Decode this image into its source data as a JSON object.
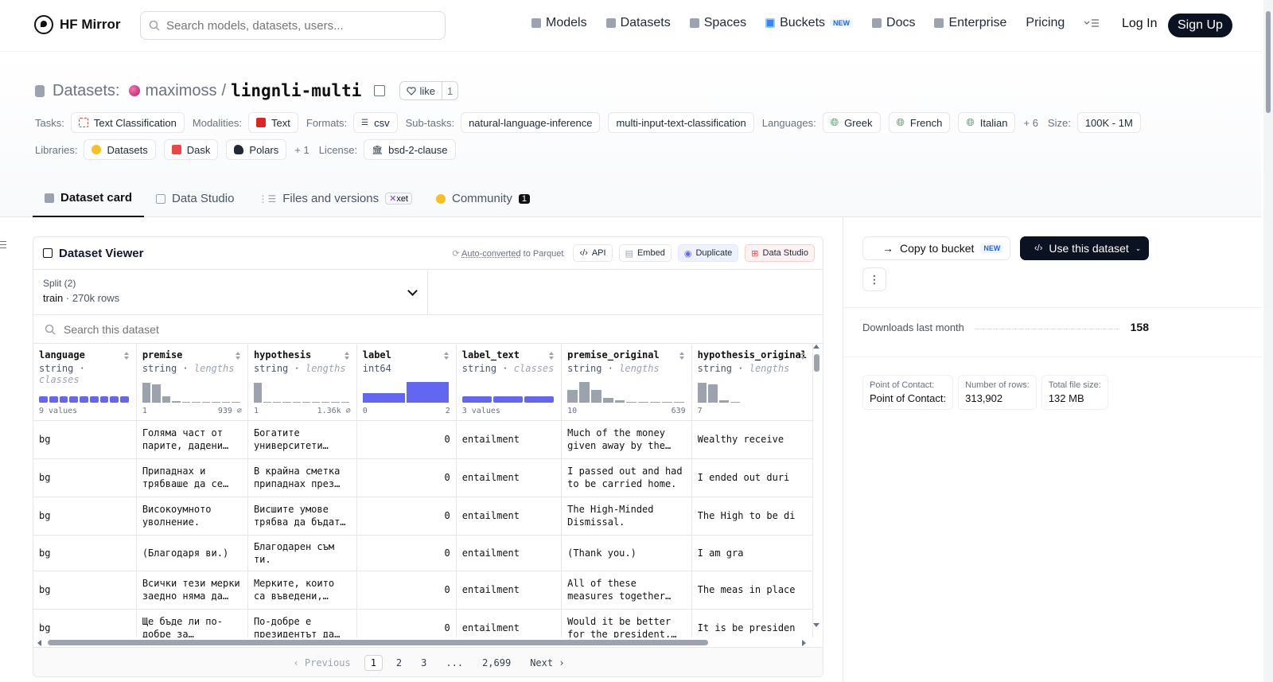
{
  "nav": {
    "brand": "HF Mirror",
    "search_placeholder": "Search models, datasets, users...",
    "links": [
      {
        "label": "Models",
        "icon": "cube-icon"
      },
      {
        "label": "Datasets",
        "icon": "database-icon"
      },
      {
        "label": "Spaces",
        "icon": "grid-icon"
      },
      {
        "label": "Buckets",
        "icon": "bucket-icon",
        "badge": "NEW"
      },
      {
        "label": "Docs",
        "icon": "book-icon"
      },
      {
        "label": "Enterprise",
        "icon": "enterprise-icon"
      },
      {
        "label": "Pricing"
      }
    ],
    "login": "Log In",
    "signup": "Sign Up"
  },
  "header": {
    "section": "Datasets:",
    "owner": "maximoss",
    "separator": "/",
    "repo": "lingnli-multi",
    "like_label": "like",
    "like_count": "1"
  },
  "tags": {
    "tasks_label": "Tasks:",
    "task": "Text Classification",
    "modalities_label": "Modalities:",
    "modality": "Text",
    "formats_label": "Formats:",
    "format": "csv",
    "subtasks_label": "Sub-tasks:",
    "subtasks": [
      "natural-language-inference",
      "multi-input-text-classification"
    ],
    "languages_label": "Languages:",
    "languages": [
      "Greek",
      "French",
      "Italian"
    ],
    "languages_more": "+ 6",
    "size_label": "Size:",
    "size": "100K - 1M",
    "libraries_label": "Libraries:",
    "libraries": [
      "Datasets",
      "Dask",
      "Polars"
    ],
    "libraries_more": "+ 1",
    "license_label": "License:",
    "license": "bsd-2-clause"
  },
  "tabs": {
    "card": "Dataset card",
    "studio": "Data Studio",
    "files": "Files and versions",
    "xet": "xet",
    "community": "Community",
    "community_count": "1"
  },
  "viewer": {
    "title": "Dataset Viewer",
    "auto_link": "Auto-converted",
    "auto_rest": "to Parquet",
    "api": "API",
    "embed": "Embed",
    "duplicate": "Duplicate",
    "studio": "Data Studio",
    "split_label": "Split (2)",
    "split_value": "train",
    "split_rows": "270k rows",
    "search_placeholder": "Search this dataset",
    "columns": [
      {
        "name": "language",
        "type": "string",
        "kind": "classes",
        "left": "9 values",
        "right": "",
        "hist": "classes",
        "bars": [
          1,
          1,
          1,
          1,
          1,
          1,
          1,
          1,
          1
        ]
      },
      {
        "name": "premise",
        "type": "string",
        "kind": "lengths",
        "left": "1",
        "right": "939 ⌀",
        "hist": "lengths",
        "bars": [
          0.95,
          0.9,
          0.3,
          0.08,
          0.05,
          0.04,
          0.03,
          0,
          0.03,
          0.02
        ]
      },
      {
        "name": "hypothesis",
        "type": "string",
        "kind": "lengths",
        "left": "1",
        "right": "1.36k ⌀",
        "hist": "lengths",
        "bars": [
          0.95,
          0.05,
          0.04,
          0.03,
          0.03,
          0.02,
          0.02,
          0.02,
          0.02,
          0.02
        ]
      },
      {
        "name": "label",
        "type": "int64",
        "kind": "",
        "left": "0",
        "right": "2",
        "hist": "two",
        "bars": [
          0.45,
          1
        ]
      },
      {
        "name": "label_text",
        "type": "string",
        "kind": "classes",
        "left": "3 values",
        "right": "",
        "hist": "classes",
        "bars": [
          1,
          1,
          1
        ]
      },
      {
        "name": "premise_original",
        "type": "string",
        "kind": "lengths",
        "left": "10",
        "right": "639",
        "hist": "lengths",
        "bars": [
          0.6,
          1,
          0.6,
          0.25,
          0.1,
          0.05,
          0.04,
          0.03,
          0.03,
          0.02
        ]
      },
      {
        "name": "hypothesis_original",
        "type": "string",
        "kind": "lengths",
        "left": "7",
        "right": "",
        "hist": "lengths",
        "bars": [
          0.95,
          0.9,
          0.1,
          0.05
        ]
      }
    ],
    "rows": [
      [
        "bg",
        "Голяма част от парите, дадени от…",
        "Богатите университети…",
        "0",
        "entailment",
        "Much of the money given away by the…",
        "Wealthy receive"
      ],
      [
        "bg",
        "Припаднах и трябваше да се…",
        "В крайна сметка припаднах през…",
        "0",
        "entailment",
        "I passed out and had to be carried home.",
        "I ended out duri"
      ],
      [
        "bg",
        "Високоумното уволнение.",
        "Висшите умове трябва да бъдат…",
        "0",
        "entailment",
        "The High-Minded Dismissal.",
        "The High to be di"
      ],
      [
        "bg",
        "(Благодаря ви.)",
        "Благодарен съм ти.",
        "0",
        "entailment",
        "(Thank you.)",
        "I am gra"
      ],
      [
        "bg",
        "Всички тези мерки заедно няма да…",
        "Мерките, които са въведени, биха…",
        "0",
        "entailment",
        "All of these measures together will not…",
        "The meas in place"
      ],
      [
        "bg",
        "Ще бъде ли по-добре за президента, а…",
        "По-добре е президентът да…",
        "0",
        "entailment",
        "Would it be better for the president, and th…",
        "It is be presiden"
      ]
    ],
    "pager": {
      "prev": "Previous",
      "pages": [
        "1",
        "2",
        "3",
        "...",
        "2,699"
      ],
      "next": "Next"
    }
  },
  "sidebar": {
    "copy": "Copy to bucket",
    "copy_badge": "NEW",
    "use": "Use this dataset",
    "more": "⋮",
    "downloads_label": "Downloads last month",
    "downloads": "158",
    "cards": [
      {
        "k": "Point of Contact:",
        "v": "Point of Contact:"
      },
      {
        "k": "Number of rows:",
        "v": "313,902"
      },
      {
        "k": "Total file size:",
        "v": "132 MB"
      }
    ]
  },
  "colors": {
    "accent": "#6366f1",
    "hist_gray": "#9ca3af",
    "dark": "#0b1221"
  }
}
